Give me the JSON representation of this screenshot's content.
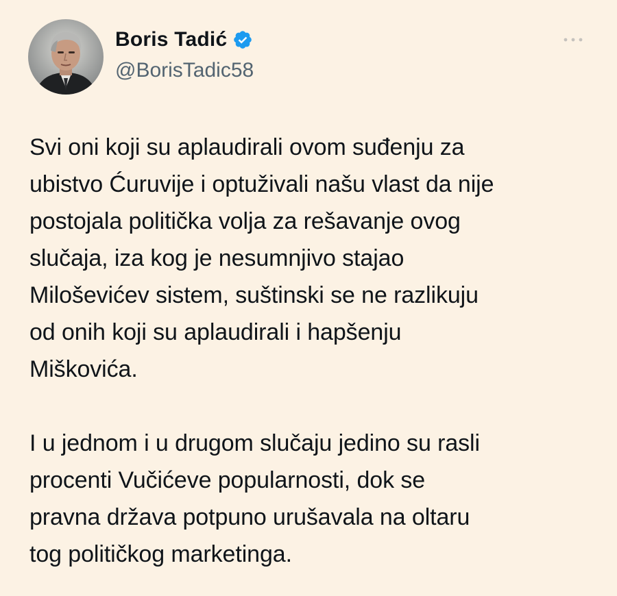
{
  "author": {
    "display_name": "Boris Tadić",
    "handle": "@BorisTadic58",
    "avatar_icon": "person-portrait-icon",
    "verified_icon": "verified-badge-icon",
    "verified_color": "#1d9bf0"
  },
  "header": {
    "more_icon": "more-options-icon"
  },
  "tweet": {
    "paragraphs": [
      "Svi oni koji su aplaudirali ovom suđenju za\nubistvo Ćuruvije i optuživali našu vlast da nije\npostojala politička volja za rešavanje ovog\nslučaja, iza kog je nesumnjivo stajao\nMiloševićev sistem, suštinski se ne razlikuju\nod onih koji su aplaudirali i hapšenju\nMiškovića.",
      "I u jednom i u drugom slučaju jedino su rasli\nprocenti Vučićeve popularnosti, dok se\npravna država potpuno urušavala na oltaru\ntog političkog marketinga."
    ]
  },
  "colors": {
    "background": "#fcf2e4",
    "text": "#0f1419",
    "secondary_text": "#536471"
  }
}
